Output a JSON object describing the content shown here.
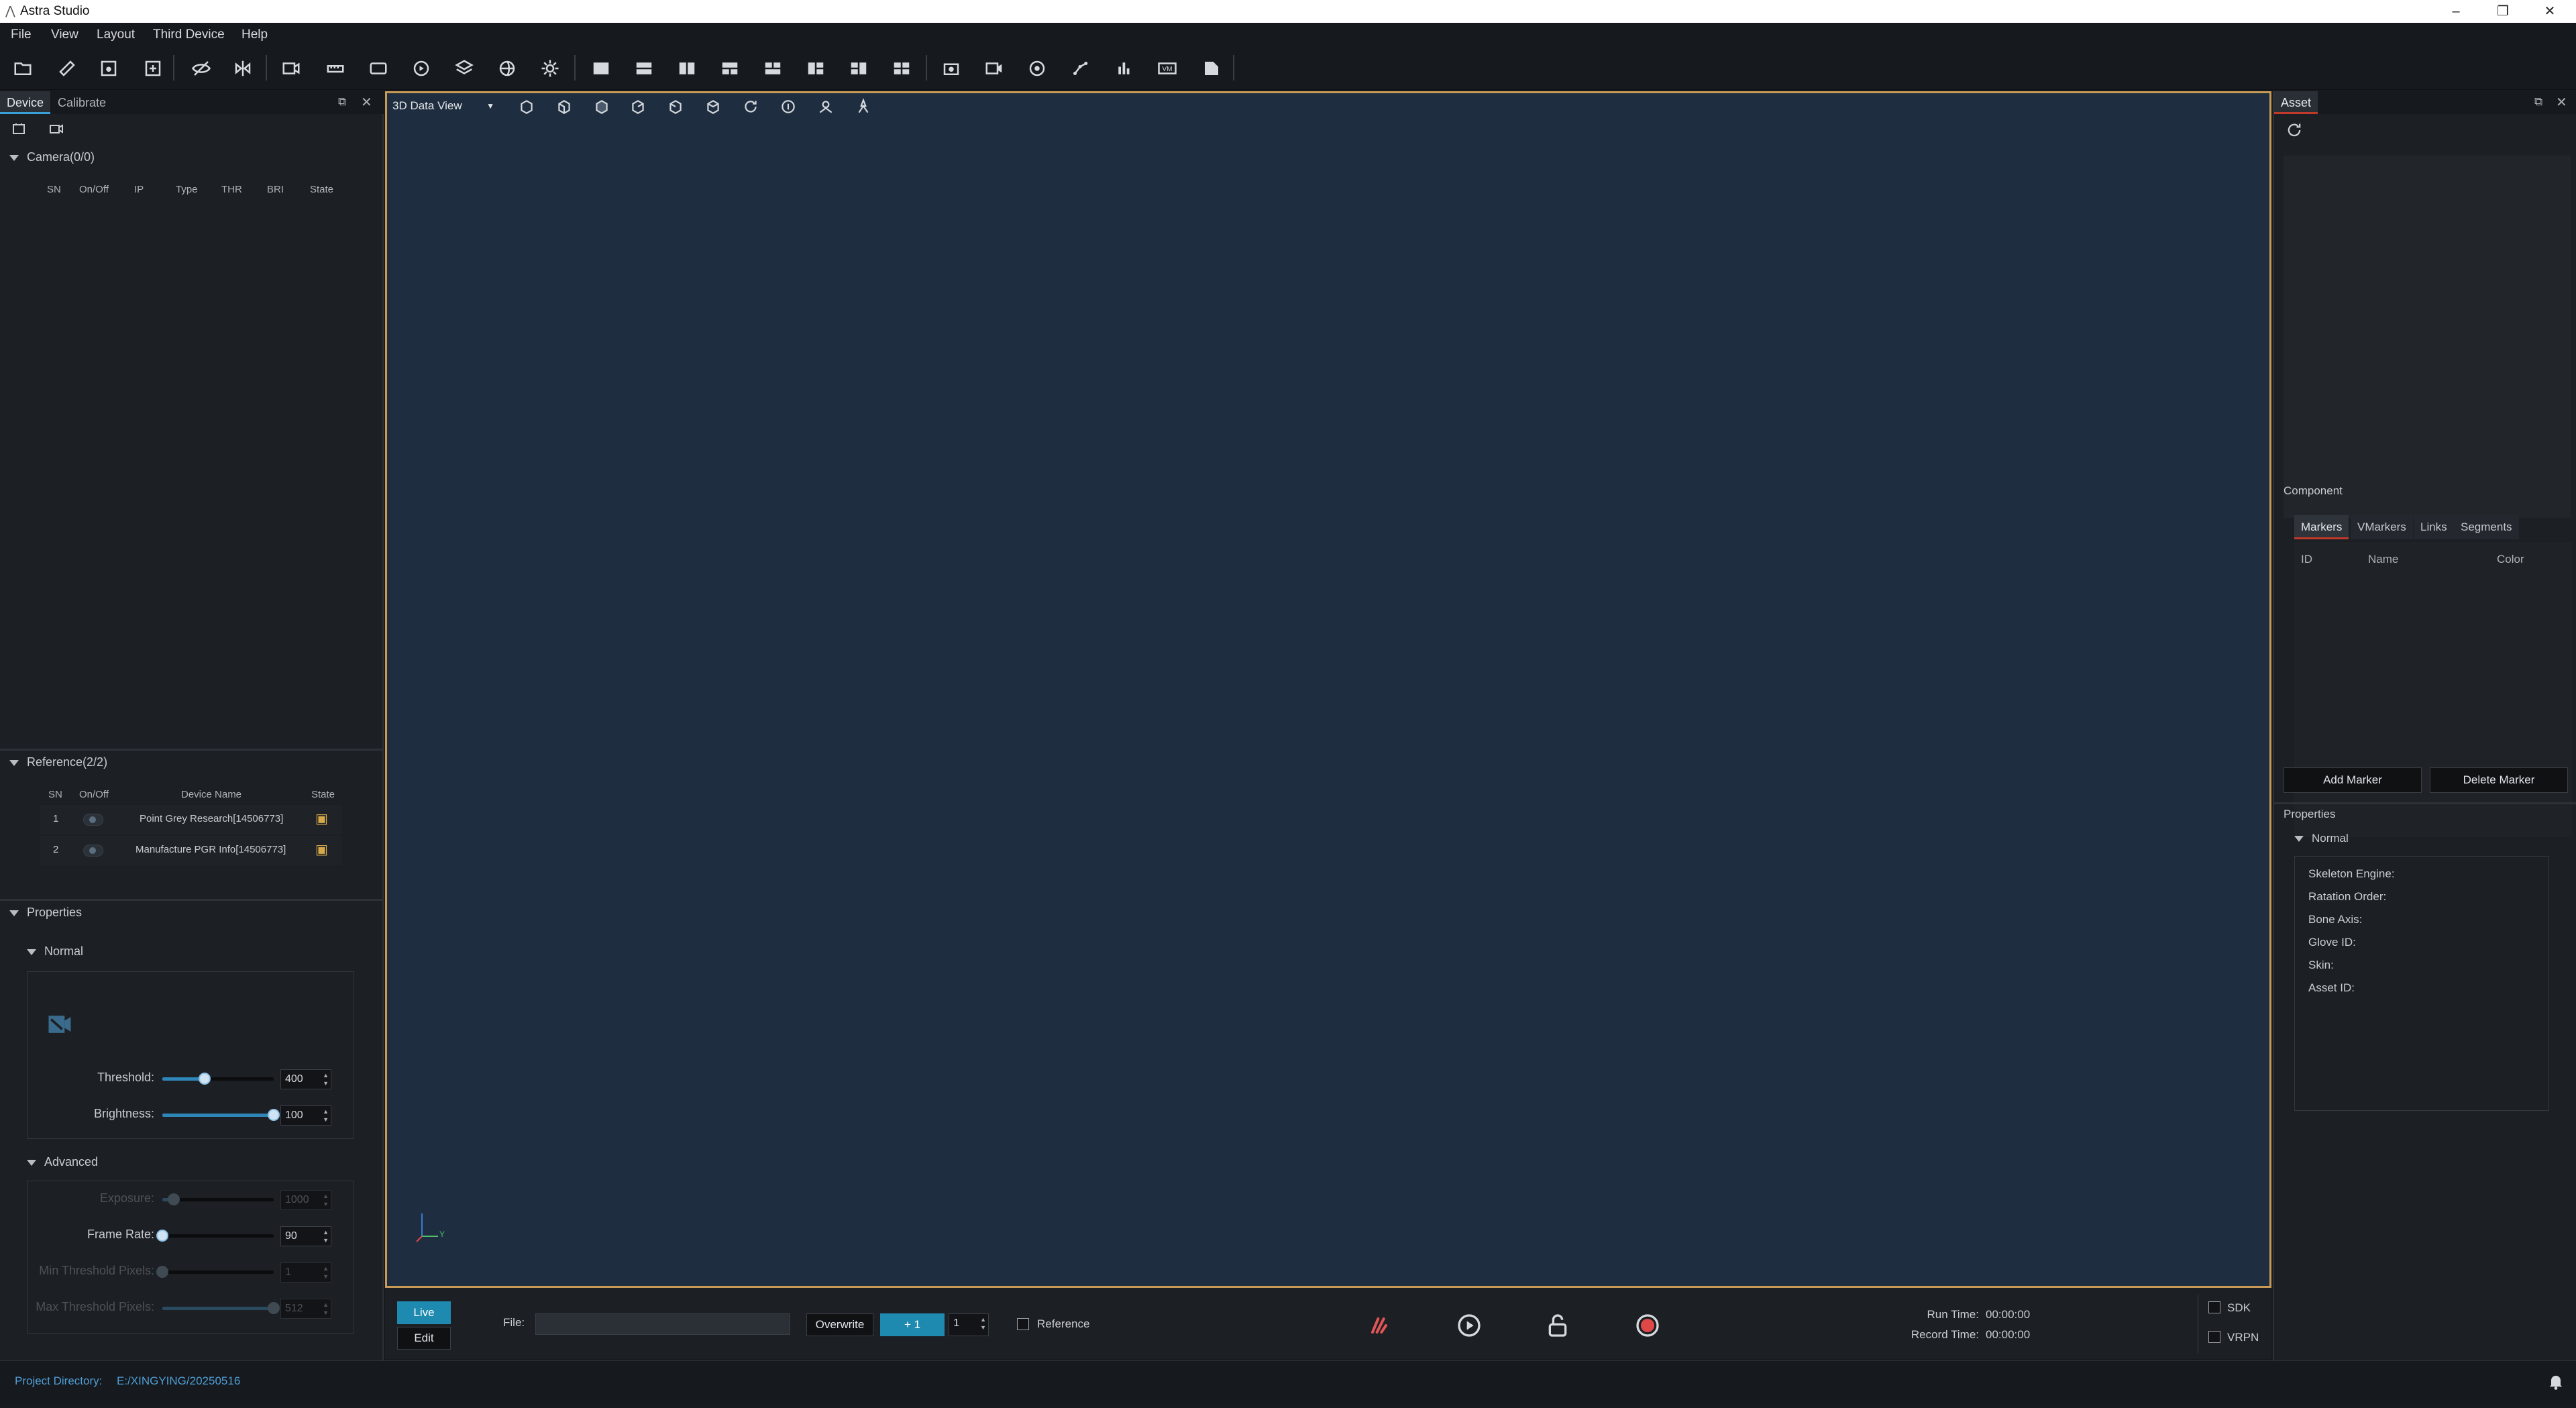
{
  "window": {
    "title": "Astra Studio",
    "controls": [
      "–",
      "❐",
      "✕"
    ]
  },
  "menu": [
    "File",
    "View",
    "Layout",
    "Third Device",
    "Help"
  ],
  "toolbar": {
    "icons": [
      "open-folder-icon",
      "ruler-icon",
      "save-icon",
      "save-as-icon",
      "hide-icon",
      "mirror-icon",
      "camera-add-icon",
      "ruler-tool-icon",
      "tag-icon",
      "refresh-icon",
      "layers-icon",
      "globe-icon",
      "settings-icon",
      "layout-single-icon",
      "layout-split-h-icon",
      "layout-split-v-icon",
      "layout-tri-top-icon",
      "layout-tri-bottom-icon",
      "layout-tri-left-icon",
      "layout-tri-right-icon",
      "layout-quad-icon",
      "camera-sync-icon",
      "video-camera-icon",
      "sphere-icon",
      "skeleton-icon",
      "bar-chart-icon",
      "vm-icon",
      "export-icon"
    ]
  },
  "left": {
    "tabs": [
      "Device",
      "Calibrate"
    ],
    "camera": {
      "header": "Camera(0/0)",
      "columns": [
        "SN",
        "On/Off",
        "IP",
        "Type",
        "THR",
        "BRI",
        "State"
      ]
    },
    "reference": {
      "header": "Reference(2/2)",
      "columns": [
        "SN",
        "On/Off",
        "Device Name",
        "State"
      ],
      "rows": [
        {
          "sn": "1",
          "name": "Point Grey Research[14506773]"
        },
        {
          "sn": "2",
          "name": "Manufacture PGR Info[14506773]"
        }
      ]
    },
    "properties": {
      "header": "Properties",
      "normal": {
        "header": "Normal",
        "threshold": {
          "label": "Threshold:",
          "value": "400",
          "level": 0.38
        },
        "brightness": {
          "label": "Brightness:",
          "value": "100",
          "level": 1.0
        }
      },
      "advanced": {
        "header": "Advanced",
        "exposure": {
          "label": "Exposure:",
          "value": "1000",
          "level": 0.1,
          "disabled": true
        },
        "frame_rate": {
          "label": "Frame Rate:",
          "value": "90",
          "level": 0.0
        },
        "min_threshold_pixels": {
          "label": "Min Threshold Pixels:",
          "value": "1",
          "level": 0.0,
          "disabled": true
        },
        "max_threshold_pixels": {
          "label": "Max Threshold Pixels:",
          "value": "512",
          "level": 1.0,
          "disabled": true
        }
      }
    }
  },
  "viewport": {
    "view_selector": "3D Data View",
    "axis_label_y": "Y"
  },
  "bottom": {
    "live_label": "Live",
    "edit_label": "Edit",
    "file_label": "File:",
    "file_value": "",
    "overwrite_label": "Overwrite",
    "increment_label": "+ 1",
    "increment_value": "1",
    "reference_label": "Reference",
    "run_time_label": "Run Time:",
    "run_time_value": "00:00:00",
    "record_time_label": "Record Time:",
    "record_time_value": "00:00:00",
    "sdk_label": "SDK",
    "vrpn_label": "VRPN"
  },
  "right": {
    "tab": "Asset",
    "component_label": "Component",
    "component_tabs": [
      "Markers",
      "VMarkers",
      "Links",
      "Segments"
    ],
    "marker_columns": [
      "ID",
      "Name",
      "Color"
    ],
    "add_marker": "Add Marker",
    "delete_marker": "Delete Marker",
    "properties_label": "Properties",
    "normal_label": "Normal",
    "props": [
      "Skeleton Engine:",
      "Ratation Order:",
      "Bone Axis:",
      "Glove ID:",
      "Skin:",
      "Asset ID:"
    ]
  },
  "status": {
    "project_label": "Project Directory:",
    "project_path": "E:/XINGYING/20250516"
  },
  "colors": {
    "accent": "#1f8ab0",
    "viewport_bg": "#1e2e40",
    "viewport_border": "#c79a55",
    "record": "#e04848"
  }
}
